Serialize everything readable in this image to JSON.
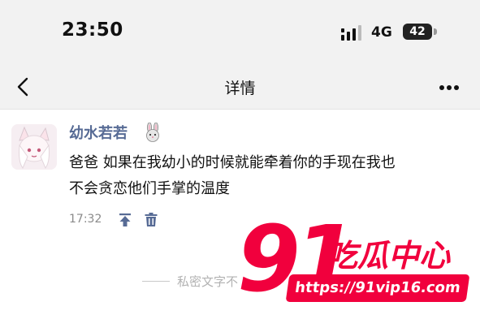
{
  "status_bar": {
    "time": "23:50",
    "network": "4G",
    "battery": "42"
  },
  "nav": {
    "title": "详情"
  },
  "post": {
    "username": "幼水若若",
    "lines": [
      "爸爸 如果在我幼小的时候就能牵着你的手现在我也",
      "不会贪恋他们手掌的温度"
    ],
    "time": "17:32"
  },
  "privacy_note": "私密文字不",
  "watermark": {
    "logo": "91吃瓜中心",
    "url": "https://91vip16.com"
  },
  "colors": {
    "username": "#576b95",
    "watermark": "#f1003d",
    "background": "#f2f2f2"
  }
}
